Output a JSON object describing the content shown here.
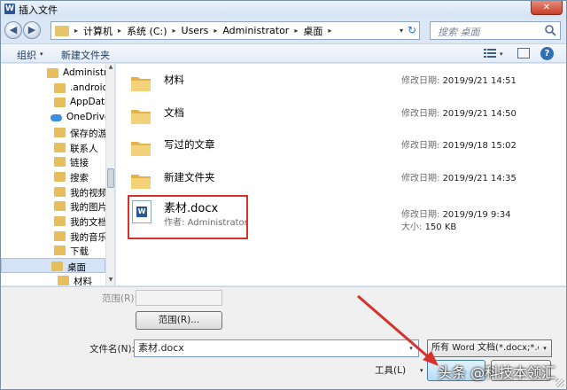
{
  "window": {
    "title": "插入文件",
    "close_glyph": "✕"
  },
  "address": {
    "crumbs": [
      "计算机",
      "系统 (C:)",
      "Users",
      "Administrator",
      "桌面"
    ],
    "separator": "▸",
    "dropdown_glyph": "▾",
    "refresh_glyph": "↻"
  },
  "search": {
    "placeholder": "搜索 桌面"
  },
  "toolbar": {
    "organize_label": "组织",
    "new_folder_label": "新建文件夹",
    "help_glyph": "?"
  },
  "nav_glyphs": {
    "back": "◀",
    "forward": "▶",
    "caret": "▾",
    "scroll_up": "▲",
    "scroll_down": "▼"
  },
  "nav_tree": [
    {
      "label": "Administrator",
      "icon": "folder"
    },
    {
      "label": ".android",
      "icon": "folder"
    },
    {
      "label": "AppData",
      "icon": "folder"
    },
    {
      "label": "OneDrive",
      "icon": "cloud"
    },
    {
      "label": "保存的游戏",
      "icon": "folder"
    },
    {
      "label": "联系人",
      "icon": "folder"
    },
    {
      "label": "链接",
      "icon": "folder"
    },
    {
      "label": "搜索",
      "icon": "folder"
    },
    {
      "label": "我的视频",
      "icon": "folder"
    },
    {
      "label": "我的图片",
      "icon": "folder"
    },
    {
      "label": "我的文档",
      "icon": "folder"
    },
    {
      "label": "我的音乐",
      "icon": "folder"
    },
    {
      "label": "下载",
      "icon": "folder"
    },
    {
      "label": "桌面",
      "icon": "folder",
      "selected": true
    },
    {
      "label": "材料",
      "icon": "folder"
    }
  ],
  "files": [
    {
      "name": "材料",
      "meta_label": "修改日期:",
      "meta_value": "2019/9/21 14:51"
    },
    {
      "name": "文档",
      "meta_label": "修改日期:",
      "meta_value": "2019/9/21 14:50"
    },
    {
      "name": "写过的文章",
      "meta_label": "修改日期:",
      "meta_value": "2019/9/18 15:02"
    },
    {
      "name": "新建文件夹",
      "meta_label": "修改日期:",
      "meta_value": "2019/9/21 14:35"
    }
  ],
  "doc_file": {
    "name": "素材.docx",
    "author_label": "作者:",
    "author": "Administrator",
    "date_label": "修改日期:",
    "date": "2019/9/19 9:34",
    "size_label": "大小:",
    "size": "150 KB"
  },
  "form": {
    "range_label": "范围(R):",
    "range_button": "范围(R)...",
    "filename_label": "文件名(N):",
    "filename_value": "素材.docx",
    "filetype_value": "所有 Word 文档(*.docx;*.docx",
    "tools_label": "工具(L)"
  },
  "watermark": "头条 @科技本领汇",
  "colors": {
    "highlight": "#d9302b",
    "arrow": "#d9302b"
  }
}
